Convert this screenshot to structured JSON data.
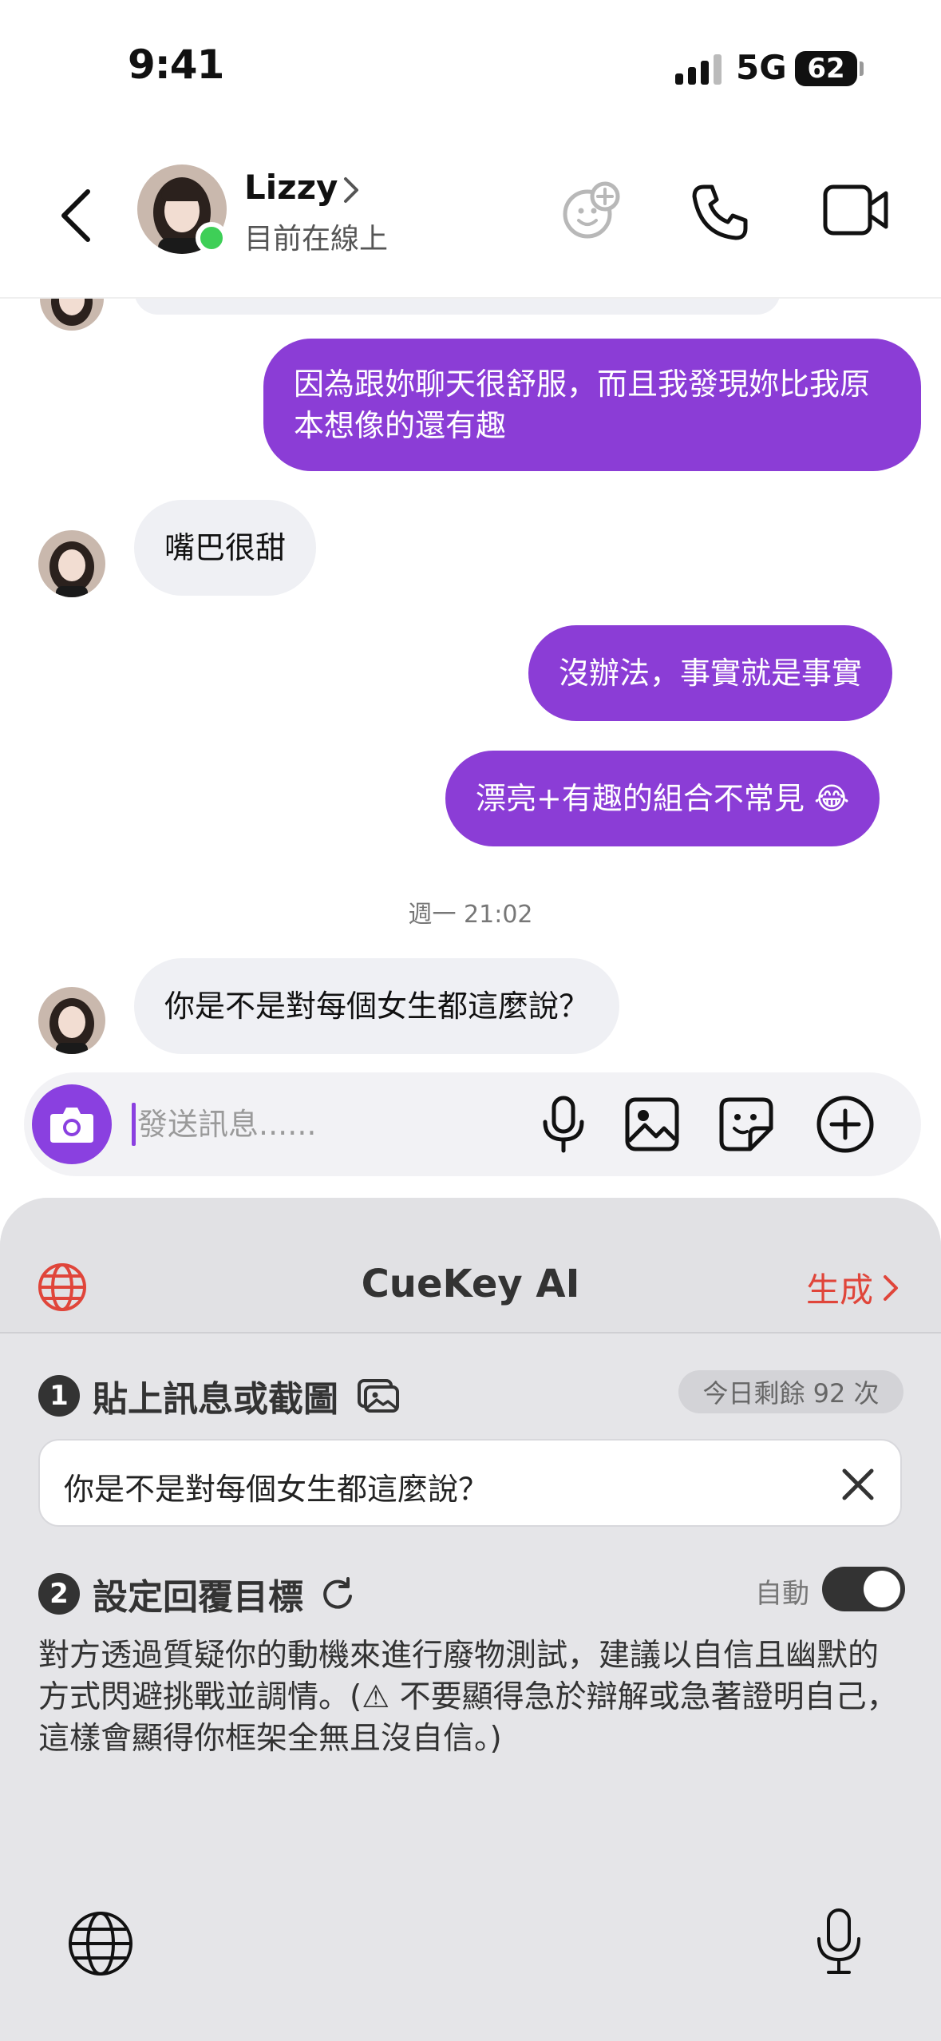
{
  "status_bar": {
    "time": "9:41",
    "network": "5G",
    "battery": "62"
  },
  "header": {
    "contact_name": "Lizzy",
    "contact_status": "目前在線上",
    "icons": [
      "back-icon",
      "chevron-right-icon",
      "emoji-plus-icon",
      "phone-icon",
      "video-icon"
    ]
  },
  "messages": [
    {
      "id": 1,
      "direction": "out",
      "text": "因為跟妳聊天很舒服，而且我發現妳比我原本想像的還有趣"
    },
    {
      "id": 2,
      "direction": "in",
      "text": "嘴巴很甜"
    },
    {
      "id": 3,
      "direction": "out",
      "text": "沒辦法，事實就是事實"
    },
    {
      "id": 4,
      "direction": "out",
      "text": "漂亮+有趣的組合不常見 😂"
    },
    {
      "id": 5,
      "direction": "in",
      "text": "你是不是對每個女生都這麼說？"
    }
  ],
  "timestamp": "週一 21:02",
  "composer": {
    "placeholder": "發送訊息......",
    "icons": [
      "camera-icon",
      "mic-icon",
      "image-icon",
      "sticker-icon",
      "plus-icon"
    ],
    "accent": "#8a40e0"
  },
  "keyboard": {
    "title": "CueKey AI",
    "generate_label": "生成",
    "step1": {
      "number": "1",
      "label": "貼上訊息或截圖"
    },
    "quota": "今日剩餘 92 次",
    "pasted_text": "你是不是對每個女生都這麼說？",
    "step2": {
      "number": "2",
      "label": "設定回覆目標"
    },
    "auto_label": "自動",
    "auto_enabled": true,
    "suggestion": "對方透過質疑你的動機來進行廢物測試，建議以自信且幽默的方式閃避挑戰並調情。(⚠ 不要顯得急於辯解或急著證明自己，這樣會顯得你框架全無且沒自信。)"
  },
  "colors": {
    "outgoing_bubble": "#8b3dd6",
    "incoming_bubble": "#eff0f4",
    "online": "#3ecf57",
    "generate": "#e0453a"
  }
}
